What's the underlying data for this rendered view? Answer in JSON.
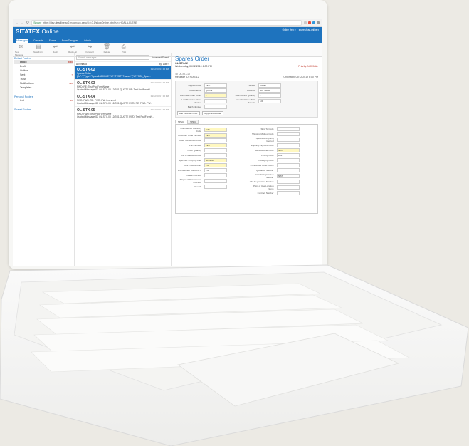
{
  "browser": {
    "url_secure": "Secure",
    "url": "https://dev-deadline.sp2.moonrack.aero/3.0.0-1/showOnline.html?un=HDALA-ELENE"
  },
  "app": {
    "brand_bold": "SITATEX",
    "brand_light": "Online",
    "help_label": "Online Help ▾",
    "user_label": "spares@ac-online ▾"
  },
  "menu": [
    "Messages",
    "Contacts",
    "Forms",
    "Form Designer",
    "Admin"
  ],
  "toolbar": [
    "New Message",
    "New Form",
    "Reply",
    "Reply All",
    "Forward",
    "Delete",
    "Print"
  ],
  "sidebar": {
    "default_folders": "Default Folders",
    "items": [
      {
        "label": "Inbox",
        "count": "3330"
      },
      {
        "label": "Draft",
        "count": ""
      },
      {
        "label": "Outbox",
        "count": ""
      },
      {
        "label": "Sent",
        "count": "7"
      },
      {
        "label": "Trash",
        "count": ""
      },
      {
        "label": "Notifications",
        "count": "790"
      },
      {
        "label": "Templates",
        "count": ""
      }
    ],
    "personal_folders": "Personal Folders",
    "personal_items": [
      {
        "label": "test",
        "count": "30"
      }
    ],
    "shared_folders": "Shared Folders"
  },
  "list": {
    "search_placeholder": "Search messages",
    "advanced": "Advanced Search",
    "filter": "All  Unread",
    "sort": "By: Date ▾",
    "messages": [
      {
        "id": "OL-STX-02",
        "date": "09/12/2019 6:00 PM",
        "subject": "Spares Order",
        "preview": "{\"Id\":\"{\"Type\":\"Spare10000045\",\"Id\":\"TEST\",\"Name\":\"{\"Id\":\"SOL_Spar..."
      },
      {
        "id": "OL-STX-03",
        "date": "09/12/2019 6:00 PM",
        "subject": "FWD: RE: Test FwdFormName",
        "preview": "Quoted Message ID: OL-STX-00 12/7/01 QUOTE RE: Test FwdFormN..."
      },
      {
        "id": "OL-STX-04",
        "date": "09/12/2019 7:00 PM",
        "subject": "FWD: FWD: RE: FWD: FW: test send",
        "preview": "Quoted Message ID: OL-STX-00 12/7/01 QUOTE FWD: RE: FWD: FW..."
      },
      {
        "id": "OL-STX-05",
        "date": "09/12/2019 7:00 PM",
        "subject": "FWD: FWD: Test FwdFormName",
        "preview": "Quoted Message ID: OL-STX-00 12/7/01 QUOTE FWD: Test FwdFormN..."
      }
    ]
  },
  "detail": {
    "title": "Spares Order",
    "id": "OL-STX-02",
    "datetime": "Wednesday, 09/12/2019 6:00 PM",
    "priority": "Priority: NORMAL",
    "to": "To:   OL-STX-07",
    "message_id": "Message ID:  FOD112",
    "originated": "Originated 09/12/2019 6:00 PM",
    "fields_left": [
      {
        "label": "Supplier Code",
        "value": "TEST1"
      },
      {
        "label": "Customer ID",
        "value": "QUOTE"
      },
      {
        "label": "Purchase Order Count",
        "value": "1"
      },
      {
        "label": "Last Purchase Order Number",
        "value": ""
      },
      {
        "label": "Batch Number",
        "value": ""
      }
    ],
    "fields_right": [
      {
        "label": "Sender",
        "value": "Unread"
      },
      {
        "label": "Receiver",
        "value": "NOT SHARE"
      },
      {
        "label": "Total Control Quantity",
        "value": "2"
      },
      {
        "label": "Extended Value Total Amount",
        "value": "4.00"
      }
    ],
    "buttons": [
      "Add Purchase Order",
      "Copy Current Order"
    ],
    "tabs": [
      "SPEC",
      "SPEC"
    ],
    "form_left": [
      "International Currency Code",
      "Customer Order Number",
      "Order Transaction Code",
      "Part Number",
      "Order Quantity",
      "Unit of Measure Code",
      "Specified Shipping Date",
      "Unit Price Amount",
      "Procurement Discount %",
      "Lease Indicator",
      "Shipment Date Control Indicator",
      "Remark"
    ],
    "form_right": [
      "Ship To Code",
      "Shipping Method Code",
      "Specified Shipping Method",
      "Shipping Payment Code",
      "Manufacturer Code",
      "Priority Code",
      "Packaging Code",
      "Price Break Order Count",
      "Quotation Number",
      "Aircraft Registration Number",
      "VAT Registration Number",
      "Point of Use Location Name",
      "Contract Number"
    ],
    "form_values": {
      "currency": "AUD",
      "order_number": "TEST",
      "part": "TEST",
      "date": "9/12/2019",
      "price": "1.00",
      "discount": "1.00",
      "manufacturer": "TEST",
      "priority": "AOG",
      "quotation": "TEST"
    }
  }
}
